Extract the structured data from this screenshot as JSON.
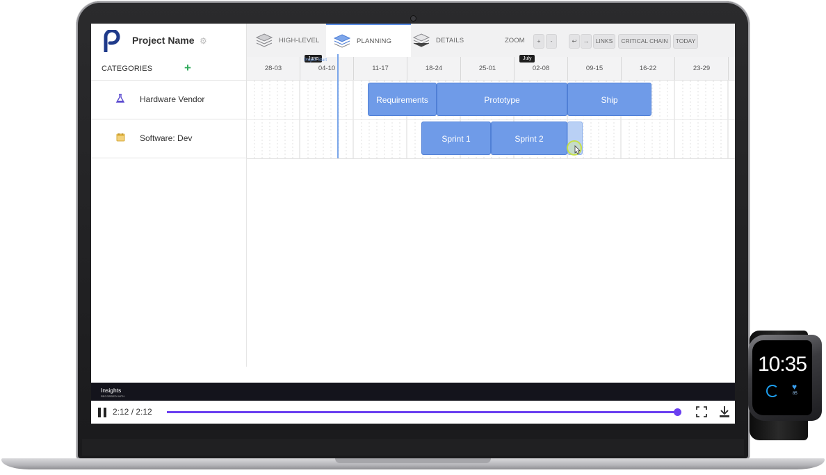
{
  "app": {
    "project_name": "Project Name",
    "logo_letter": "P"
  },
  "views": [
    {
      "label": "HIGH-LEVEL",
      "active": false
    },
    {
      "label": "PLANNING",
      "active": true
    },
    {
      "label": "DETAILS",
      "active": false
    }
  ],
  "toolbar": {
    "zoom_label": "ZOOM",
    "zoom_in": "+",
    "zoom_out": "-",
    "undo": "↩",
    "redo": "→",
    "links": "LINKS",
    "critical_chain": "CRITICAL CHAIN",
    "today": "TODAY"
  },
  "categories_header": {
    "label": "CATEGORIES",
    "add": "+"
  },
  "months": [
    {
      "label": "June"
    },
    {
      "label": "July"
    }
  ],
  "today_marker_label": "Project Start",
  "weeks": [
    "28-03",
    "04-10",
    "11-17",
    "18-24",
    "25-01",
    "02-08",
    "09-15",
    "16-22",
    "23-29"
  ],
  "categories": [
    {
      "name": "Hardware Vendor",
      "icon": "flask-icon",
      "icon_color": "#5b4bcf"
    },
    {
      "name": "Software: Dev",
      "icon": "calendar-icon",
      "icon_color": "#e2b84a"
    }
  ],
  "tasks": [
    {
      "label": "Requirements",
      "row": 0
    },
    {
      "label": "Prototype",
      "row": 0
    },
    {
      "label": "Ship",
      "row": 0
    },
    {
      "label": "Sprint 1",
      "row": 1
    },
    {
      "label": "Sprint 2",
      "row": 1
    },
    {
      "label": "",
      "row": 1
    }
  ],
  "insights": {
    "label": "Insights",
    "sub": "RECORDED WITH"
  },
  "player": {
    "time": "2:12 / 2:12",
    "progress": 1.0,
    "accent": "#6a3ff0"
  },
  "watch": {
    "time": "10:35",
    "heart_rate": "85"
  },
  "colors": {
    "task_bar": "#6f9be8",
    "today_line": "#7aa6ea",
    "add_green": "#2eaa5a"
  }
}
